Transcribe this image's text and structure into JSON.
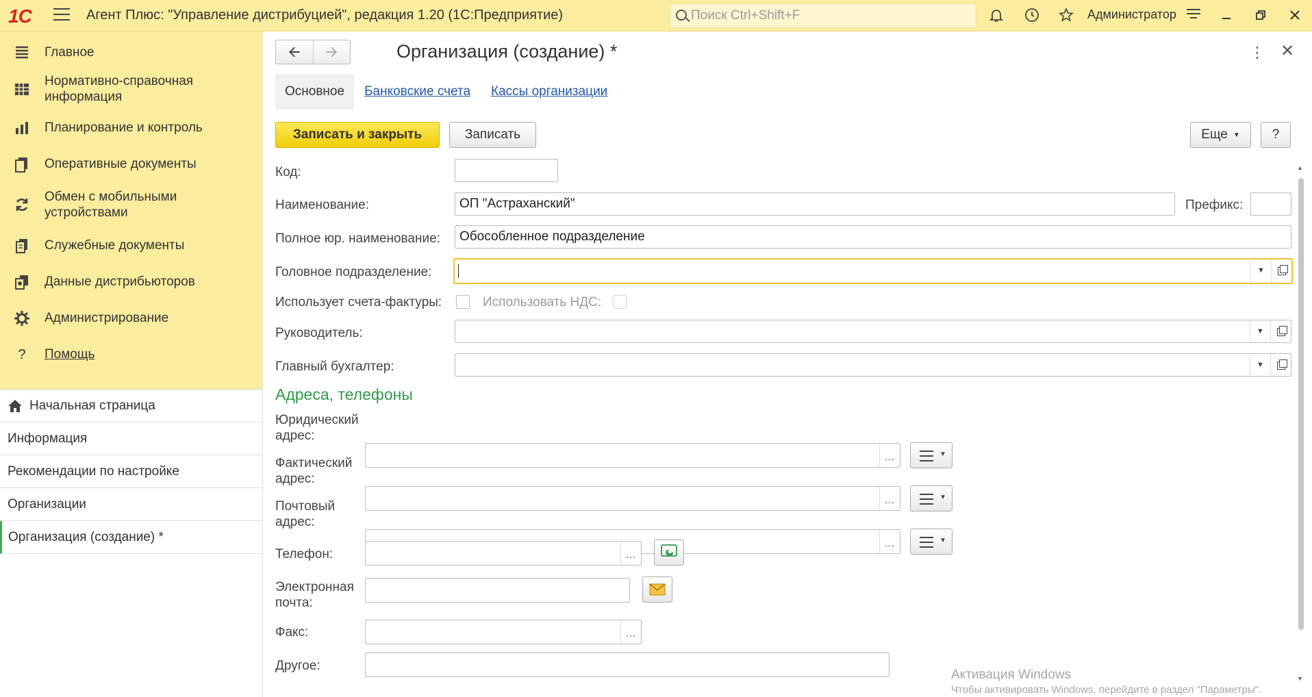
{
  "titlebar": {
    "logo": "1С",
    "title": "Агент Плюс: \"Управление дистрибуцией\", редакция 1.20  (1С:Предприятие)",
    "search_placeholder": "Поиск Ctrl+Shift+F",
    "user": "Администратор"
  },
  "sidebar": {
    "sections": [
      {
        "label": "Главное",
        "icon": "list-icon"
      },
      {
        "label": "Нормативно-справочная информация",
        "icon": "catalog-icon"
      },
      {
        "label": "Планирование и контроль",
        "icon": "chart-icon"
      },
      {
        "label": "Оперативные документы",
        "icon": "documents-icon"
      },
      {
        "label": "Обмен с мобильными устройствами",
        "icon": "sync-icon"
      },
      {
        "label": "Служебные документы",
        "icon": "service-docs-icon"
      },
      {
        "label": "Данные дистрибьюторов",
        "icon": "distributor-data-icon"
      },
      {
        "label": "Администрирование",
        "icon": "gear-icon"
      },
      {
        "label": "Помощь",
        "icon": "question-icon"
      }
    ],
    "open_windows": [
      {
        "label": "Начальная страница"
      },
      {
        "label": "Информация"
      },
      {
        "label": "Рекомендации по настройке"
      },
      {
        "label": "Организации"
      },
      {
        "label": "Организация (создание) *"
      }
    ]
  },
  "form": {
    "title": "Организация (создание) *",
    "tabs": [
      "Основное",
      "Банковские счета",
      "Кассы организации"
    ],
    "buttons": {
      "save_close": "Записать и закрыть",
      "save": "Записать",
      "more": "Еще",
      "help": "?"
    },
    "fields": {
      "code_label": "Код:",
      "code_value": "",
      "name_label": "Наименование:",
      "name_value": "ОП \"Астраханский\"",
      "prefix_label": "Префикс:",
      "prefix_value": "",
      "fullname_label": "Полное юр. наименование:",
      "fullname_value": "Обособленное подразделение",
      "head_label": "Головное подразделение:",
      "head_value": "",
      "invoices_label": "Использует счета-фактуры:",
      "vat_label": "Использовать НДС:",
      "director_label": "Руководитель:",
      "director_value": "",
      "accountant_label": "Главный бухгалтер:",
      "accountant_value": ""
    },
    "contacts": {
      "section_title": "Адреса, телефоны",
      "legal_label_1": "Юридический",
      "legal_label_2": "адрес:",
      "actual_label_1": "Фактический",
      "actual_label_2": "адрес:",
      "postal_label_1": "Почтовый",
      "postal_label_2": "адрес:",
      "phone_label": "Телефон:",
      "email_label_1": "Электронная",
      "email_label_2": "почта:",
      "fax_label": "Факс:",
      "other_label": "Другое:"
    }
  },
  "watermark": {
    "line1": "Активация Windows",
    "line2": "Чтобы активировать Windows, перейдите в раздел \"Параметры\"."
  },
  "colors": {
    "header_bg": "#fbed9e",
    "primary_button": "#f1cd08",
    "section_title": "#2f9b4b",
    "link": "#2457a8",
    "focus_border": "#f1c232"
  }
}
